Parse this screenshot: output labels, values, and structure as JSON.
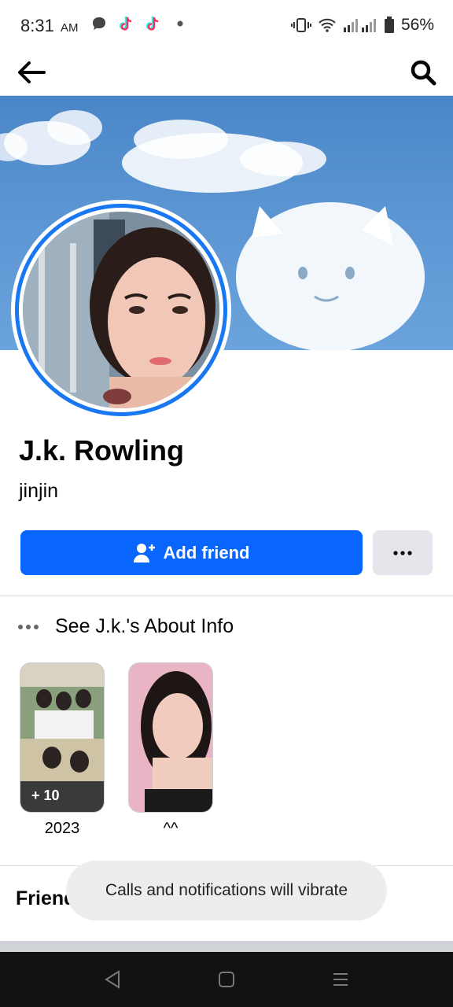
{
  "status_bar": {
    "time": "8:31",
    "ampm": "AM",
    "battery": "56%",
    "icons": [
      "chat-bubble-icon",
      "tiktok-icon",
      "tiktok-icon",
      "dot-icon",
      "vibrate-icon",
      "wifi-icon",
      "signal-icon",
      "battery-icon"
    ]
  },
  "app_bar": {
    "back_icon": "arrow-left-icon",
    "search_icon": "search-icon"
  },
  "profile": {
    "name": "J.k. Rowling",
    "nickname": "jinjin"
  },
  "actions": {
    "add_friend_label": "Add friend",
    "add_friend_icon": "add-person-icon",
    "more_icon": "more-dots-icon"
  },
  "about": {
    "label": "See J.k.'s About Info",
    "icon": "more-dots-icon"
  },
  "featured": [
    {
      "label": "2023",
      "count": "+ 10"
    },
    {
      "label": "^^"
    }
  ],
  "friends": {
    "heading": "Friends"
  },
  "toast": {
    "text": "Calls and notifications will vibrate"
  },
  "colors": {
    "accent": "#0866ff",
    "secondary_button": "#e4e6eb",
    "ring": "#1877f2"
  }
}
